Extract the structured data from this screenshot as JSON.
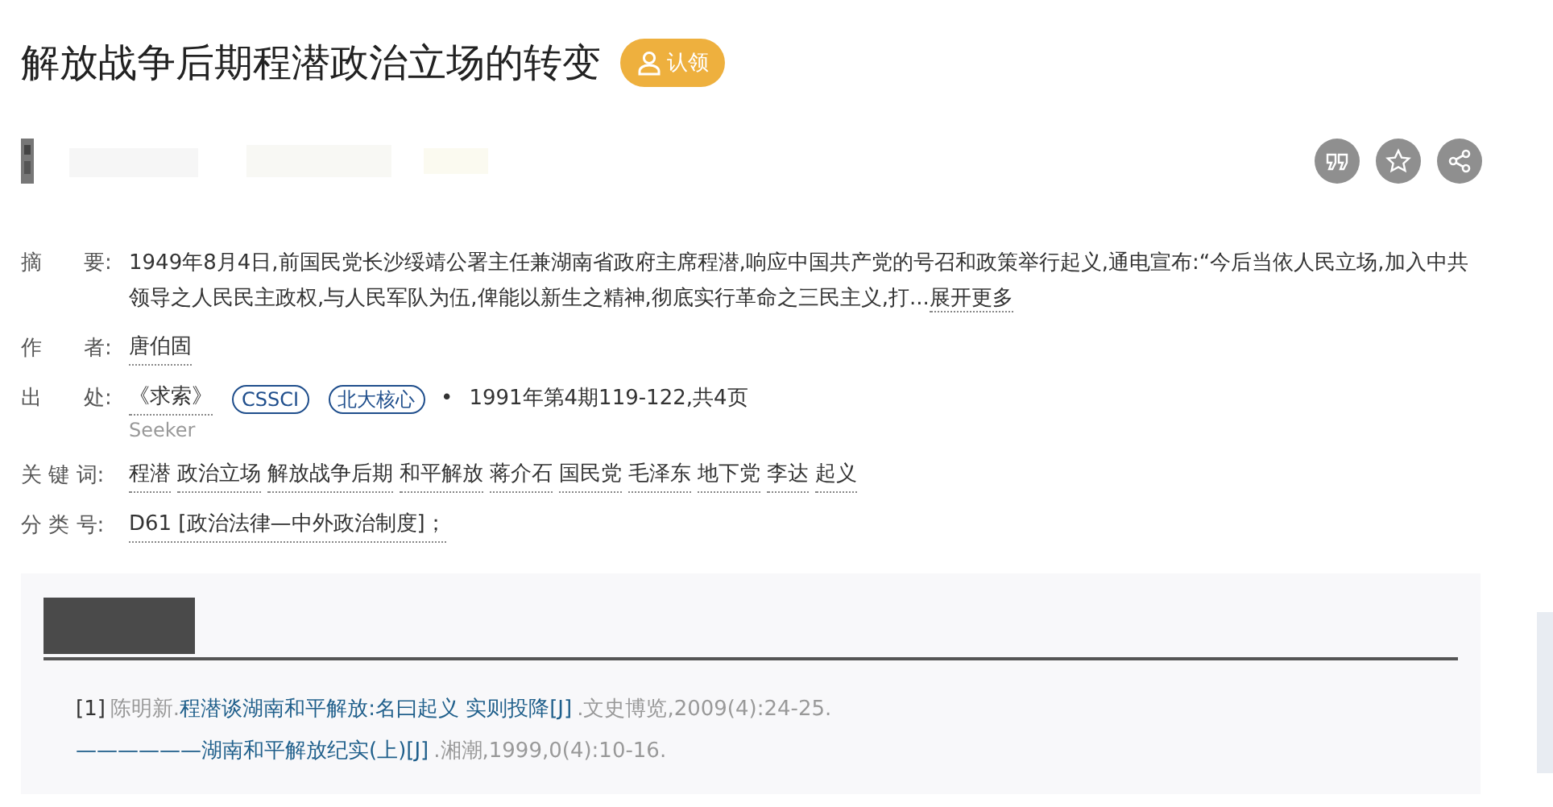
{
  "title": "解放战争后期程潜政治立场的转变",
  "claim_button": "认领",
  "fields": [
    {
      "kind": "text",
      "label": "摘　　要:",
      "text": "1949年8月4日,前国民党长沙绥靖公署主任兼湖南省政府主席程潜,响应中国共产党的号召和政策举行起义,通电宣布:“今后当依人民立场,加入中共领导之人民民主政权,与人民军队为伍,俾能以新生之精神,彻底实行革命之三民主义,打...",
      "more": "展开更多"
    },
    {
      "kind": "links",
      "label": "作　　者:",
      "links": [
        "唐伯固"
      ]
    },
    {
      "kind": "source",
      "label": "出　　处:",
      "journal": "《求索》",
      "tags": [
        "CSSCI",
        "北大核心"
      ],
      "separator": "•",
      "issue": "1991年第4期119-122,共4页",
      "subtitle": "Seeker"
    },
    {
      "kind": "links",
      "label": "关 键 词:",
      "links": [
        "程潜",
        "政治立场",
        "解放战争后期",
        "和平解放",
        "蒋介石",
        "国民党",
        "毛泽东",
        "地下党",
        "李达",
        "起义"
      ]
    },
    {
      "kind": "links",
      "label": "分 类 号:",
      "links": [
        "D61 [政治法律—中外政治制度]；"
      ]
    }
  ],
  "references": [
    {
      "index": "[1]",
      "author": "陈明新.",
      "title": "程潜谈湖南和平解放:名曰起义 实则投降[J]",
      "source": ".文史博览,2009(4):24-25."
    },
    {
      "title": "——————湖南和平解放纪实(上)[J]",
      "source": ".湘潮,1999,0(4):10-16."
    }
  ]
}
